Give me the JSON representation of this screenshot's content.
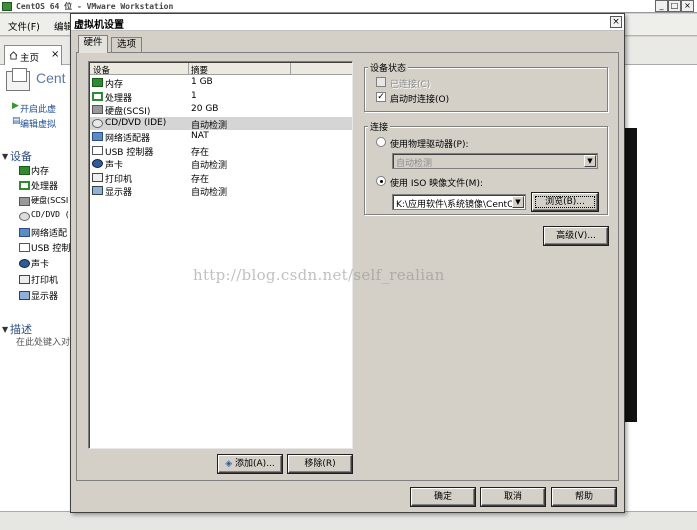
{
  "main_window": {
    "title": "CentOS 64 位 - VMware Workstation",
    "controls": {
      "minimize": "_",
      "maximize": "□",
      "close": "×"
    },
    "menu": [
      "文件(F)",
      "编辑"
    ],
    "home_tab": {
      "label": "主页",
      "close": "×"
    },
    "vm_title": "Cent",
    "actions": [
      "开启此虚",
      "编辑虚拟"
    ],
    "devices_section": "设备",
    "devices": [
      "内存",
      "处理器",
      "硬盘(SCSI",
      "CD/DVD (",
      "网络适配",
      "USB 控制",
      "声卡",
      "打印机",
      "显示器"
    ],
    "desc_section": "描述",
    "desc_text": "在此处键入对"
  },
  "dialog": {
    "title": "虚拟机设置",
    "close": "×",
    "tabs": [
      {
        "label": "硬件",
        "active": true
      },
      {
        "label": "选项",
        "active": false
      }
    ],
    "device_list": {
      "columns": [
        "设备",
        "摘要"
      ],
      "rows": [
        {
          "name": "内存",
          "summary": "1 GB",
          "icon": "memory-icon"
        },
        {
          "name": "处理器",
          "summary": "1",
          "icon": "processor-icon"
        },
        {
          "name": "硬盘(SCSI)",
          "summary": "20 GB",
          "icon": "hard-disk-icon"
        },
        {
          "name": "CD/DVD (IDE)",
          "summary": "自动检测",
          "icon": "cd-dvd-icon",
          "selected": true
        },
        {
          "name": "网络适配器",
          "summary": "NAT",
          "icon": "network-adapter-icon"
        },
        {
          "name": "USB 控制器",
          "summary": "存在",
          "icon": "usb-controller-icon"
        },
        {
          "name": "声卡",
          "summary": "自动检测",
          "icon": "sound-card-icon"
        },
        {
          "name": "打印机",
          "summary": "存在",
          "icon": "printer-icon"
        },
        {
          "name": "显示器",
          "summary": "自动检测",
          "icon": "display-icon"
        }
      ]
    },
    "buttons": {
      "add": "添加(A)...",
      "remove": "移除(R)",
      "ok": "确定",
      "cancel": "取消",
      "help": "帮助",
      "advanced": "高级(V)...",
      "browse": "浏览(B)..."
    },
    "device_status": {
      "legend": "设备状态",
      "connected": {
        "label": "已连接(C)",
        "checked": false,
        "disabled": true
      },
      "connect_at_power_on": {
        "label": "启动时连接(O)",
        "checked": true
      }
    },
    "connection": {
      "legend": "连接",
      "physical_drive": {
        "label": "使用物理驱动器(P):",
        "selected": false,
        "combo_value": "自动检测"
      },
      "iso_image": {
        "label": "使用 ISO 映像文件(M):",
        "selected": true,
        "path": "K:\\应用软件\\系统镜像\\CentO"
      }
    }
  },
  "watermark": "http://blog.csdn.net/self_realian",
  "colors": {
    "accent_text": "#1f4fa0",
    "section_text": "#2a4e8a",
    "dialog_bg": "#d4d0c8"
  }
}
